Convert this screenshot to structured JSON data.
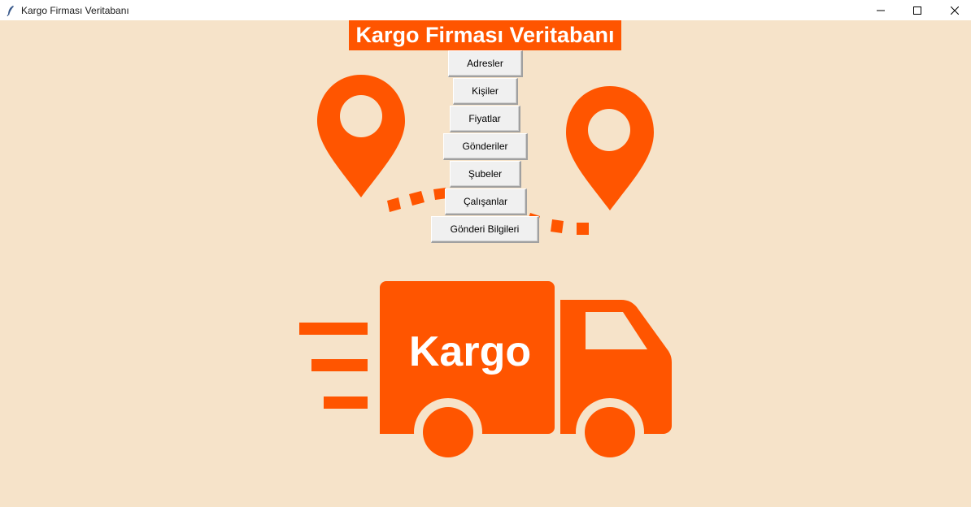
{
  "window": {
    "title": "Kargo Firması Veritabanı",
    "icon": "feather-icon",
    "controls": [
      "minimize-icon",
      "maximize-icon",
      "close-icon"
    ]
  },
  "header": {
    "title": "Kargo Firması Veritabanı"
  },
  "menu": {
    "buttons": [
      {
        "label": "Adresler"
      },
      {
        "label": "Kişiler"
      },
      {
        "label": "Fiyatlar"
      },
      {
        "label": "Gönderiler"
      },
      {
        "label": "Şubeler"
      },
      {
        "label": "Çalışanlar"
      },
      {
        "label": "Gönderi Bilgileri"
      }
    ]
  },
  "illustration": {
    "truck_text": "Kargo",
    "icons": [
      "location-pin-icon",
      "location-pin-icon",
      "delivery-truck-icon",
      "dotted-route-icon",
      "speed-lines-icon"
    ]
  },
  "colors": {
    "background": "#f6e3c9",
    "accent": "#ff5500",
    "button_face": "#f0f0f0"
  }
}
